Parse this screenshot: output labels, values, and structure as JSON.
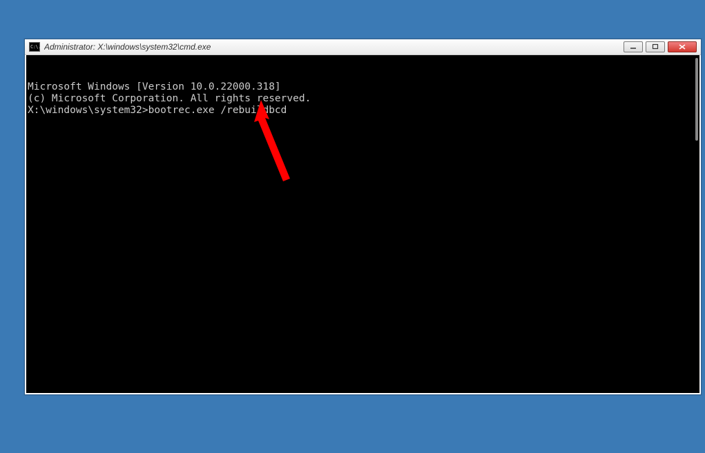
{
  "window": {
    "title": "Administrator: X:\\windows\\system32\\cmd.exe",
    "icon_label": "cmd-icon",
    "icon_text": "C:\\."
  },
  "console": {
    "line1": "Microsoft Windows [Version 10.0.22000.318]",
    "line2": "(c) Microsoft Corporation. All rights reserved.",
    "blank": "",
    "prompt": "X:\\windows\\system32>",
    "command": "bootrec.exe /rebuildbcd"
  },
  "buttons": {
    "minimize": "Minimize",
    "maximize": "Maximize",
    "close": "Close"
  },
  "annotation": {
    "color": "#ff0000"
  }
}
